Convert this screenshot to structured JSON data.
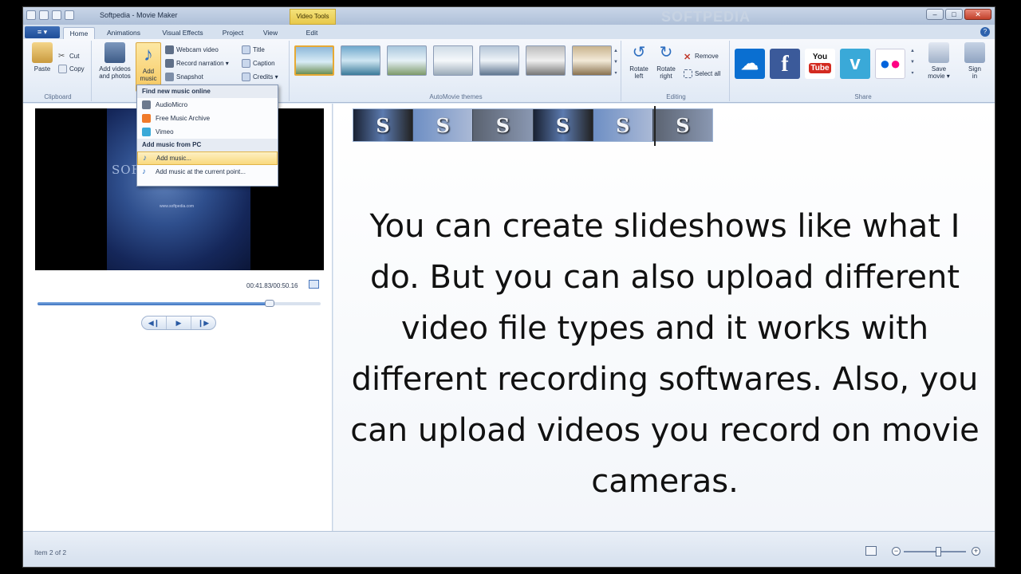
{
  "window": {
    "title": "Softpedia - Movie Maker",
    "contextual_tab": "Video Tools",
    "watermark": "SOFTPEDIA"
  },
  "tabs": [
    "Home",
    "Animations",
    "Visual Effects",
    "Project",
    "View",
    "Edit"
  ],
  "file_button": "≡ ▾",
  "clipboard": {
    "label": "Clipboard",
    "paste": "Paste",
    "cut": "Cut",
    "copy": "Copy"
  },
  "add": {
    "add_videos_line1": "Add videos",
    "add_videos_line2": "and photos",
    "add_music_line1": "Add",
    "add_music_line2": "music ▾",
    "webcam": "Webcam video",
    "narration": "Record narration ▾",
    "snapshot": "Snapshot",
    "title": "Title",
    "caption": "Caption",
    "credits": "Credits ▾"
  },
  "themes": {
    "label": "AutoMovie themes"
  },
  "editing": {
    "label": "Editing",
    "rotate_left_1": "Rotate",
    "rotate_left_2": "left",
    "rotate_right_1": "Rotate",
    "rotate_right_2": "right",
    "remove": "Remove",
    "select_all": "Select all"
  },
  "share": {
    "label": "Share",
    "save_movie_1": "Save",
    "save_movie_2": "movie ▾",
    "sign_in_1": "Sign",
    "sign_in_2": "in"
  },
  "music_menu": {
    "header_online": "Find new music online",
    "online_items": [
      "AudioMicro",
      "Free Music Archive",
      "Vimeo"
    ],
    "header_pc": "Add music from PC",
    "pc_items": [
      "Add music...",
      "Add music at the current point..."
    ]
  },
  "preview": {
    "slide_text": "SOFTPEDIA",
    "slide_url": "www.softpedia.com",
    "time": "00:41.83/00:50.16",
    "seek_fraction": 0.82
  },
  "clip_frames": [
    "S",
    "S",
    "S",
    "S",
    "S",
    "S"
  ],
  "caption": "You can create slideshows like what I do. But you can also upload different video file types and it works with different recording softwares. Also, you can upload videos you record on movie cameras.",
  "status": {
    "text": "Item 2 of 2",
    "zoom_fraction": 0.55
  },
  "colors": {
    "accent": "#e7a934",
    "file_button": "#2a5aa8"
  }
}
